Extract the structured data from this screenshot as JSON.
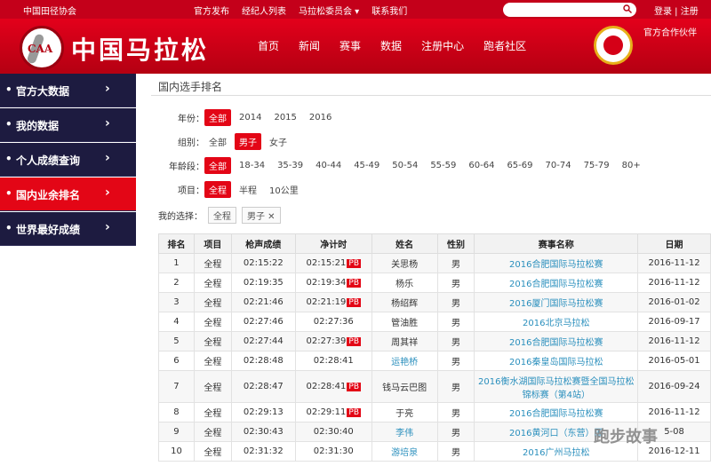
{
  "topbar": {
    "org": "中国田径协会",
    "nav": [
      "官方发布",
      "经纪人列表",
      "马拉松委员会 ▾",
      "联系我们"
    ],
    "auth": "登录 | 注册"
  },
  "header": {
    "logo_badge": "CAA",
    "logo_text": "中国马拉松",
    "nav": [
      "首页",
      "新闻",
      "赛事",
      "数据",
      "注册中心",
      "跑者社区"
    ],
    "partner": "官方合作伙伴"
  },
  "sidebar": {
    "items": [
      {
        "label": "官方大数据"
      },
      {
        "label": "我的数据"
      },
      {
        "label": "个人成绩查询"
      },
      {
        "label": "国内业余排名"
      },
      {
        "label": "世界最好成绩"
      }
    ],
    "active_index": 3
  },
  "page": {
    "title": "国内选手排名"
  },
  "filters": {
    "year": {
      "label": "年份：",
      "options": [
        "全部",
        "2014",
        "2015",
        "2016"
      ],
      "selected": 0
    },
    "group": {
      "label": "组别：",
      "options": [
        "全部",
        "男子",
        "女子"
      ],
      "selected": 1
    },
    "age": {
      "label": "年龄段：",
      "options": [
        "全部",
        "18-34",
        "35-39",
        "40-44",
        "45-49",
        "50-54",
        "55-59",
        "60-64",
        "65-69",
        "70-74",
        "75-79",
        "80+"
      ],
      "selected": 0
    },
    "event": {
      "label": "项目：",
      "options": [
        "全程",
        "半程",
        "10公里"
      ],
      "selected": 0
    }
  },
  "chosen": {
    "label": "我的选择：",
    "tags": [
      "全程",
      "男子 ✕"
    ]
  },
  "table": {
    "headers": [
      "排名",
      "项目",
      "枪声成绩",
      "净计时",
      "姓名",
      "性别",
      "赛事名称",
      "日期"
    ],
    "rows": [
      {
        "rank": "1",
        "event": "全程",
        "gun": "02:15:22",
        "net": "02:15:21",
        "pb": "PB",
        "name": "关思杨",
        "sex": "男",
        "race": "2016合肥国际马拉松赛",
        "date": "2016-11-12"
      },
      {
        "rank": "2",
        "event": "全程",
        "gun": "02:19:35",
        "net": "02:19:34",
        "pb": "PB",
        "name": "杨乐",
        "sex": "男",
        "race": "2016合肥国际马拉松赛",
        "date": "2016-11-12"
      },
      {
        "rank": "3",
        "event": "全程",
        "gun": "02:21:46",
        "net": "02:21:19",
        "pb": "PB",
        "name": "杨绍辉",
        "sex": "男",
        "race": "2016厦门国际马拉松赛",
        "date": "2016-01-02"
      },
      {
        "rank": "4",
        "event": "全程",
        "gun": "02:27:46",
        "net": "02:27:36",
        "pb": "",
        "name": "管油胜",
        "sex": "男",
        "race": "2016北京马拉松",
        "date": "2016-09-17"
      },
      {
        "rank": "5",
        "event": "全程",
        "gun": "02:27:44",
        "net": "02:27:39",
        "pb": "PB",
        "name": "周其祥",
        "sex": "男",
        "race": "2016合肥国际马拉松赛",
        "date": "2016-11-12"
      },
      {
        "rank": "6",
        "event": "全程",
        "gun": "02:28:48",
        "net": "02:28:41",
        "pb": "",
        "name": "运艳桥",
        "sex": "男",
        "race": "2016秦皇岛国际马拉松",
        "date": "2016-05-01"
      },
      {
        "rank": "7",
        "event": "全程",
        "gun": "02:28:47",
        "net": "02:28:41",
        "pb": "PB",
        "name": "钱马云巴图",
        "sex": "男",
        "race": "2016衡水湖国际马拉松赛暨全国马拉松锦标赛（第4站）",
        "date": "2016-09-24"
      },
      {
        "rank": "8",
        "event": "全程",
        "gun": "02:29:13",
        "net": "02:29:11",
        "pb": "PB",
        "name": "于亮",
        "sex": "男",
        "race": "2016合肥国际马拉松赛",
        "date": "2016-11-12"
      },
      {
        "rank": "9",
        "event": "全程",
        "gun": "02:30:43",
        "net": "02:30:40",
        "pb": "",
        "name": "李伟",
        "sex": "男",
        "race": "2016黄河口（东营）国",
        "date": "5-08"
      },
      {
        "rank": "10",
        "event": "全程",
        "gun": "02:31:32",
        "net": "02:31:30",
        "pb": "",
        "name": "游培泉",
        "sex": "男",
        "race": "2016广州马拉松",
        "date": "2016-12-11"
      }
    ]
  },
  "watermark": "跑步故事",
  "colors": {
    "brand_red": "#e30616",
    "sidebar_dark": "#1d1b40",
    "link_blue": "#2a8fbd"
  }
}
